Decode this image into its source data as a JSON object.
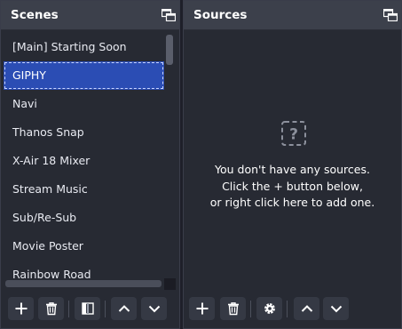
{
  "scenes": {
    "title": "Scenes",
    "items": [
      {
        "label": "[Main] Starting Soon"
      },
      {
        "label": "GIPHY"
      },
      {
        "label": "Navi"
      },
      {
        "label": "Thanos Snap"
      },
      {
        "label": "X-Air 18 Mixer"
      },
      {
        "label": "Stream Music"
      },
      {
        "label": "Sub/Re-Sub"
      },
      {
        "label": "Movie Poster"
      },
      {
        "label": "Rainbow Road"
      }
    ],
    "selected": "GIPHY",
    "toolbar_icons": [
      "plus-icon",
      "trash-icon",
      "filter-icon",
      "chevron-up-icon",
      "chevron-down-icon"
    ]
  },
  "sources": {
    "title": "Sources",
    "empty_message": [
      "You don't have any sources.",
      "Click the + button below,",
      "or right click here to add one."
    ],
    "toolbar_icons": [
      "plus-icon",
      "trash-icon",
      "gear-icon",
      "chevron-up-icon",
      "chevron-down-icon"
    ]
  },
  "colors": {
    "dock_bg": "#272a33",
    "header_bg": "#3c404b",
    "selection": "#2b4db4",
    "button_bg": "#353944"
  }
}
